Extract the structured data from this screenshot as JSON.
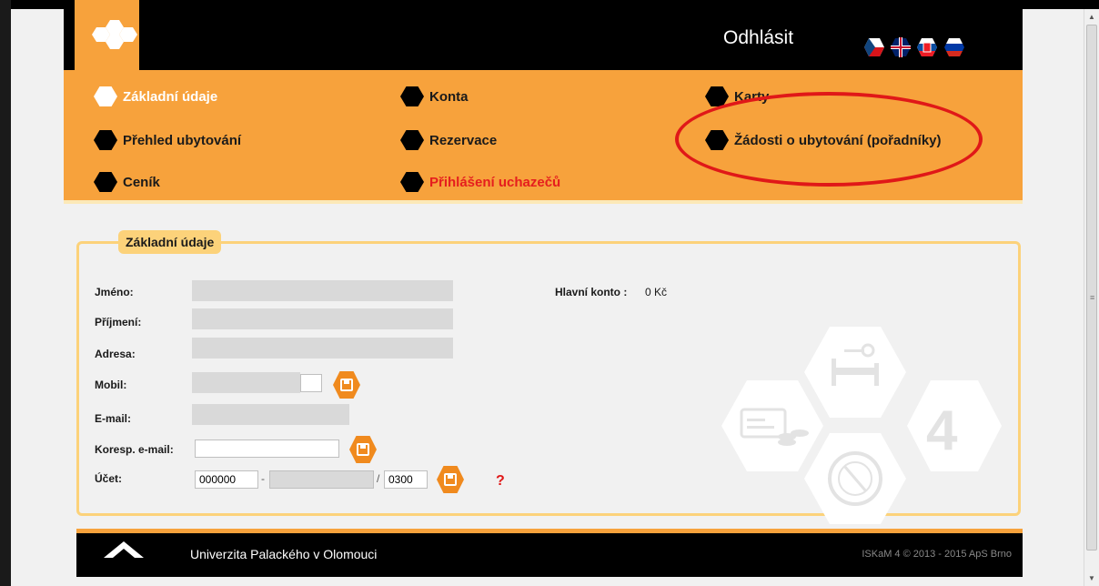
{
  "header": {
    "logout_label": "Odhlásit",
    "flags": [
      "czech-flag",
      "uk-flag",
      "slovak-flag",
      "russian-flag"
    ]
  },
  "nav": {
    "items": [
      {
        "label": "Základní údaje",
        "active": true
      },
      {
        "label": "Konta"
      },
      {
        "label": "Karty"
      },
      {
        "label": "Přehled ubytování"
      },
      {
        "label": "Rezervace"
      },
      {
        "label": "Žádosti o ubytování (pořadníky)"
      },
      {
        "label": "Ceník"
      },
      {
        "label": "Přihlášení uchazečů",
        "highlight_color": "#e51e1e"
      }
    ]
  },
  "info": {
    "legend": "Základní údaje",
    "labels": {
      "jmeno": "Jméno:",
      "prijmeni": "Příjmení:",
      "adresa": "Adresa:",
      "mobil": "Mobil:",
      "email": "E-mail:",
      "koresp": "Koresp. e-mail:",
      "ucet": "Účet:"
    },
    "hlavni_konto_label": "Hlavní konto :",
    "hlavni_konto_value": "0 Kč",
    "account": {
      "prefix": "000000",
      "separator": "-",
      "number": "",
      "bank_separator": "/",
      "bank_code": "0300"
    },
    "help_symbol": "?",
    "watermark_number": "4"
  },
  "footer": {
    "university": "Univerzita Palackého v Olomouci",
    "copyright": "ISKaM 4 © 2013 - 2015 ApS Brno"
  },
  "colors": {
    "accent": "#f7a23c",
    "save_button": "#f08a1e",
    "highlight_red": "#e01818"
  }
}
